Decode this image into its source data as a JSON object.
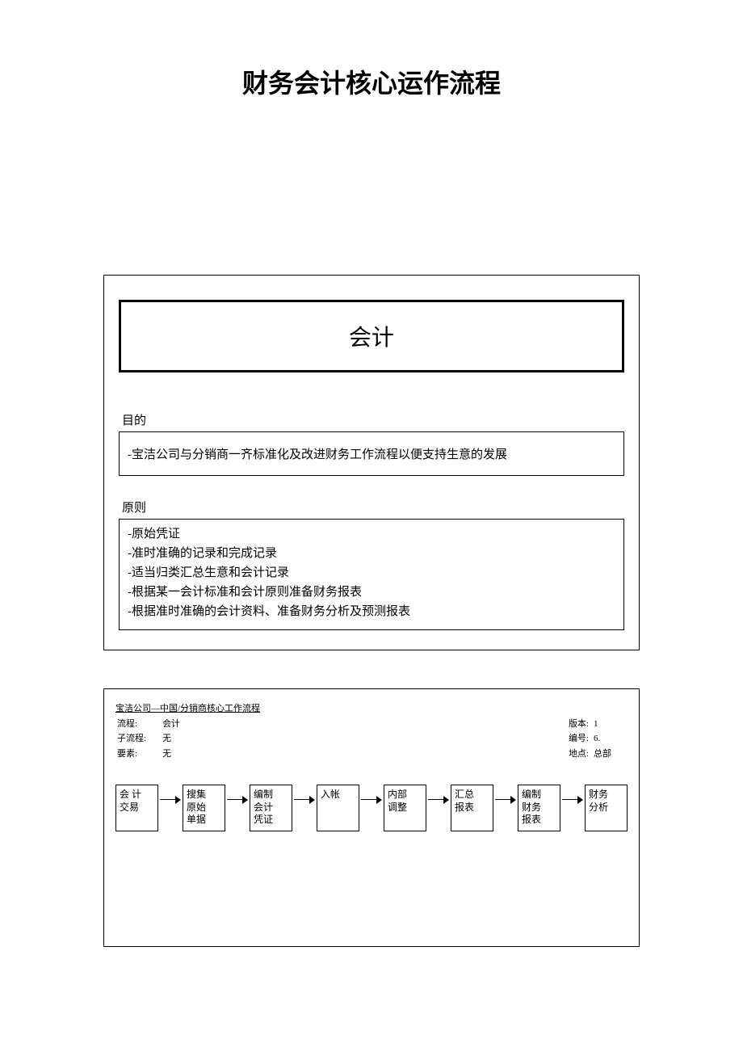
{
  "title": "财务会计核心运作流程",
  "panel1": {
    "banner": "会计",
    "purpose_label": "目的",
    "purpose_text": "-宝洁公司与分销商一齐标准化及改进财务工作流程以便支持生意的发展",
    "principles_label": "原则",
    "principles": [
      "-原始凭证",
      "-准时准确的记录和完成记录",
      "-适当归类汇总生意和会计记录",
      "-根据某一会计标准和会计原则准备财务报表",
      "-根据准时准确的会计资料、准备财务分析及预测报表"
    ]
  },
  "panel2": {
    "meta_title": "宝洁公司—中国/分销商核心工作流程",
    "left": [
      {
        "k": "流程:",
        "v": "会计"
      },
      {
        "k": "子流程:",
        "v": "无"
      },
      {
        "k": "要素:",
        "v": "无"
      }
    ],
    "right": [
      {
        "k": "版本:",
        "v": "1"
      },
      {
        "k": "编号:",
        "v": "6."
      },
      {
        "k": "地点:",
        "v": "总部"
      }
    ],
    "flow": [
      "会 计\n交易",
      "搜集\n原始\n单据",
      "编制\n会计\n凭证",
      "入帐",
      "内部\n调整",
      "汇总\n报表",
      "编制\n财务\n报表",
      "财务\n分析"
    ]
  }
}
